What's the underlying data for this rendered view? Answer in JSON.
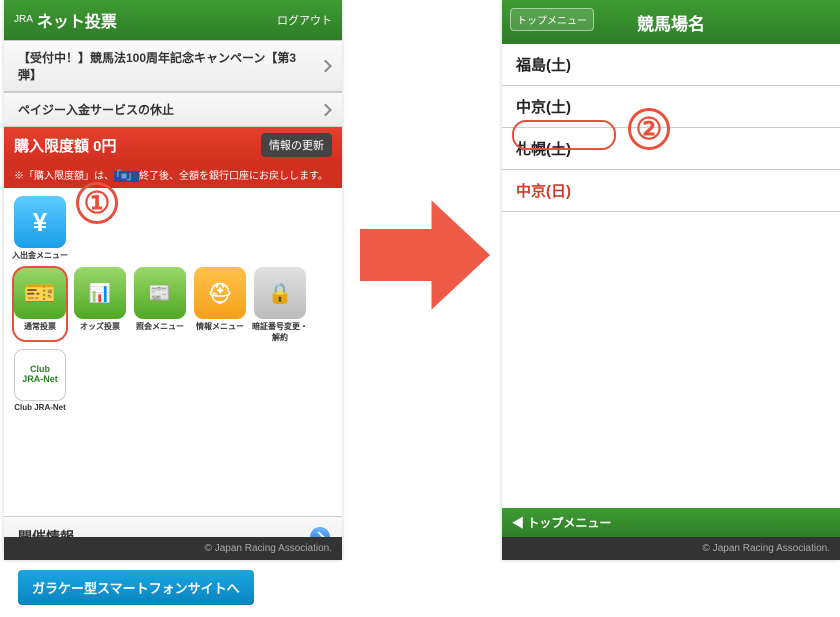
{
  "left": {
    "header": {
      "logo": "JRA",
      "title": "ネット投票",
      "logout": "ログアウト"
    },
    "notice1": "【受付中！】競馬法100周年記念キャンペーン【第3弾】",
    "notice2": "ペイジー入金サービスの休止",
    "redbar_title": "購入限度額 0円",
    "redbar_btn": "情報の更新",
    "rednote_pre": "※「購入限度額」は、",
    "rednote_link": "「■」",
    "rednote_post": "終了後、全額を銀行口座にお戻しします。",
    "icons": {
      "deposit": "入出金メニュー",
      "vote": "通常投票",
      "odds": "オッズ投票",
      "inquiry": "照会メニュー",
      "info": "情報メニュー",
      "pin": "暗証番号変更・解約",
      "club": "Club JRA-Net"
    },
    "info_row": "開催情報",
    "blue_btn": "ガラケー型スマートフォンサイトへ",
    "copyright": "© Japan Racing Association."
  },
  "right": {
    "top_menu": "トップメニュー",
    "header_title": "競馬場名",
    "tracks": [
      "福島(土)",
      "中京(土)",
      "札幌(土)",
      "中京(日)"
    ],
    "footer_nav": "◀ トップメニュー",
    "copyright": "© Japan Racing Association."
  },
  "callouts": {
    "one": "①",
    "two": "②"
  }
}
